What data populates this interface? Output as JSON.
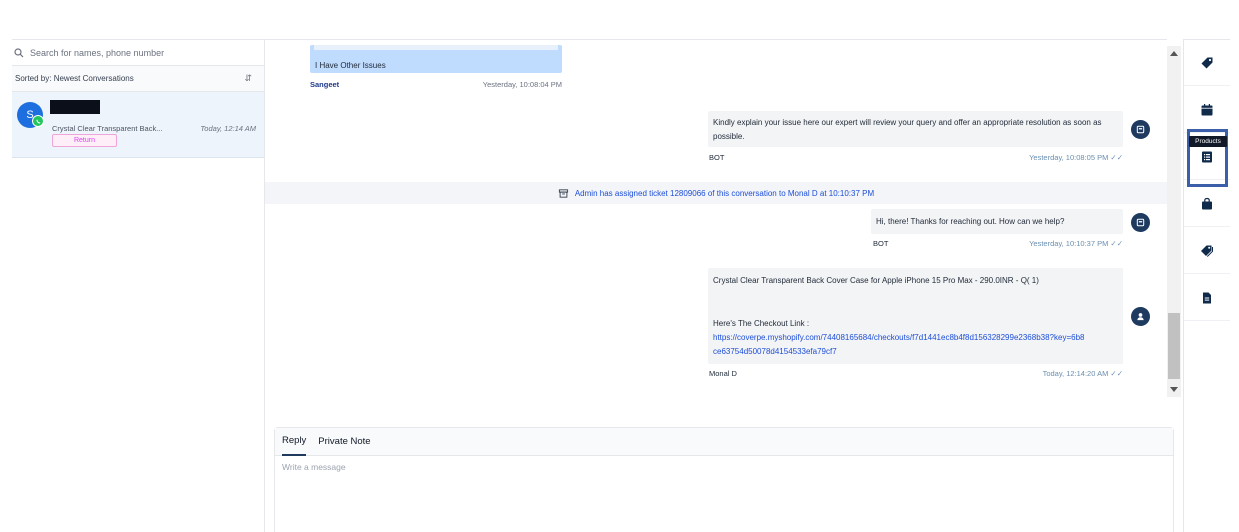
{
  "left": {
    "search_placeholder": "Search for names, phone number",
    "sort_label": "Sorted by: Newest Conversations",
    "conversation": {
      "avatar_letter": "S",
      "preview": "Crystal Clear Transparent Back...",
      "time": "Today, 12:14 AM",
      "tag": "Return"
    }
  },
  "chat": {
    "blue_bubble_text": "I Have Other Issues",
    "blue_sender": "Sangeet",
    "blue_time": "Yesterday, 10:08:04 PM",
    "bot_message_1": "Kindly explain your issue here our expert will review your query and offer an appropriate resolution as soon as possible.",
    "bot_sender_1": "BOT",
    "bot_time_1": "Yesterday, 10:08:05 PM",
    "system_notice": "Admin has assigned ticket 12809066 of this conversation to Monal D at 10:10:37 PM",
    "bot_message_2": "Hi, there! Thanks for reaching out. How can we help?",
    "bot_sender_2": "BOT",
    "bot_time_2": "Yesterday, 10:10:37 PM",
    "agent_line_1": "Crystal Clear Transparent Back Cover Case for Apple iPhone 15 Pro Max - 290.0INR - Q( 1)",
    "agent_line_2": "Here's  The Checkout Link  :",
    "agent_link": "https://coverpe.myshopify.com/74408165684/checkouts/f7d1441ec8b4f8d156328299e2368b38?key=6b8ce63754d50078d4154533efa79cf7",
    "agent_sender": "Monal D",
    "agent_time": "Today, 12:14:20 AM",
    "tick": "✓✓"
  },
  "composer": {
    "tab_reply": "Reply",
    "tab_private": "Private Note",
    "placeholder": "Write a message"
  },
  "rail": {
    "tooltip": "Products",
    "icons": [
      "tag-icon",
      "calendar-icon",
      "products-icon",
      "shopping-bag-icon",
      "tags-icon",
      "document-icon"
    ]
  },
  "colors": {
    "accent": "#1e3a5f",
    "link": "#1d4ed8",
    "blue_bubble": "#bfdbfe",
    "highlight": "#3b5fa8"
  }
}
